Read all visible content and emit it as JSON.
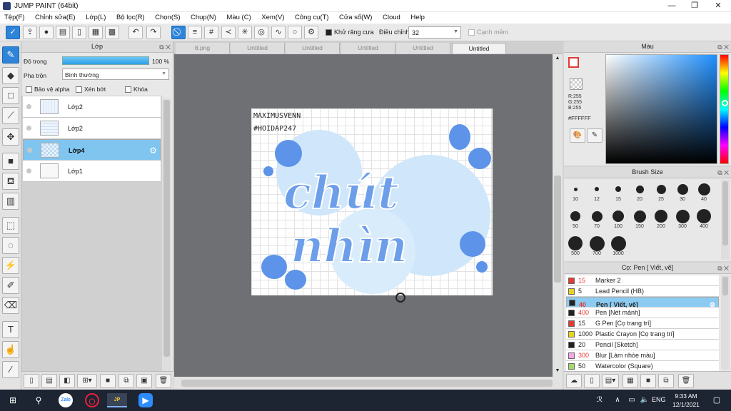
{
  "window": {
    "title": "JUMP PAINT (64bit)",
    "minimize": "—",
    "maximize": "❐",
    "close": "✕"
  },
  "menu": [
    "Tệp(F)",
    "Chỉnh sửa(E)",
    "Lớp(L)",
    "Bộ lọc(R)",
    "Chọn(S)",
    "Chụp(N)",
    "Màu (C)",
    "Xem(V)",
    "Công cụ(T)",
    "Cửa sổ(W)",
    "Cloud",
    "Help"
  ],
  "toolbar": {
    "antialias_label": "Khử răng cưa",
    "adjust_label": "Điều chỉnh",
    "adjust_value": "32",
    "sharpen_label": "Cạnh mềm"
  },
  "layer_panel": {
    "title": "Lớp",
    "opacity_label": "Độ trong",
    "opacity_value": "100 %",
    "opacity_percent": 100,
    "blend_label": "Pha trộn",
    "blend_value": "Bình thường",
    "protect_alpha": "Bảo vệ alpha",
    "clip": "Xén bớt",
    "lock": "Khóa",
    "layers": [
      {
        "name": "Lớp2",
        "selected": false
      },
      {
        "name": "Lớp2",
        "selected": false
      },
      {
        "name": "Lớp4",
        "selected": true
      },
      {
        "name": "Lớp1",
        "selected": false
      }
    ]
  },
  "tabs": [
    {
      "label": "8.png",
      "current": false
    },
    {
      "label": "Untitled",
      "current": false
    },
    {
      "label": "Untitled",
      "current": false
    },
    {
      "label": "Untitled",
      "current": false
    },
    {
      "label": "Untitled",
      "current": false
    },
    {
      "label": "Untitled",
      "current": true
    }
  ],
  "canvas": {
    "signature": "MAXIMUSVENN",
    "hashtag": "#HOIDAP247",
    "art_text": [
      "chút",
      "nhìn"
    ]
  },
  "color_panel": {
    "title": "Màu",
    "r": "R:255",
    "g": "G:255",
    "b": "B:255",
    "hex": "#FFFFFF"
  },
  "brush_panel": {
    "title": "Brush Size",
    "sizes": [
      "10",
      "12",
      "15",
      "20",
      "25",
      "30",
      "40",
      "50",
      "70",
      "100",
      "150",
      "200",
      "300",
      "400",
      "500",
      "700",
      "1000"
    ]
  },
  "pen_panel": {
    "title": "Cọ: Pen [ Viết, vẽ]",
    "items": [
      {
        "size": "15",
        "name": "Marker 2",
        "color": "#e53935",
        "size_red": true
      },
      {
        "size": "5",
        "name": "Lead Pencil (HB)",
        "color": "#e8d21c",
        "size_red": false
      },
      {
        "size": "40",
        "name": "Pen [ Viết, vẽ]",
        "color": "#222222",
        "size_red": true,
        "selected": true
      },
      {
        "size": "400",
        "name": "Pen [Nét mảnh]",
        "color": "#222222",
        "size_red": true
      },
      {
        "size": "15",
        "name": "G Pen [Cọ trang trí]",
        "color": "#e53935",
        "size_red": false
      },
      {
        "size": "1000",
        "name": "Plastic Crayon [Cọ trang trí]",
        "color": "#e8d21c",
        "size_red": false
      },
      {
        "size": "20",
        "name": "Pencil [Sketch]",
        "color": "#222222",
        "size_red": false
      },
      {
        "size": "300",
        "name": "Blur [Làm nhòe màu]",
        "color": "#f4a6e6",
        "size_red": true
      },
      {
        "size": "50",
        "name": "Watercolor (Square)",
        "color": "#a5d86a",
        "size_red": false
      }
    ]
  },
  "taskbar": {
    "time": "9:33 AM",
    "date": "12/1/2021",
    "lang": "ENG"
  }
}
